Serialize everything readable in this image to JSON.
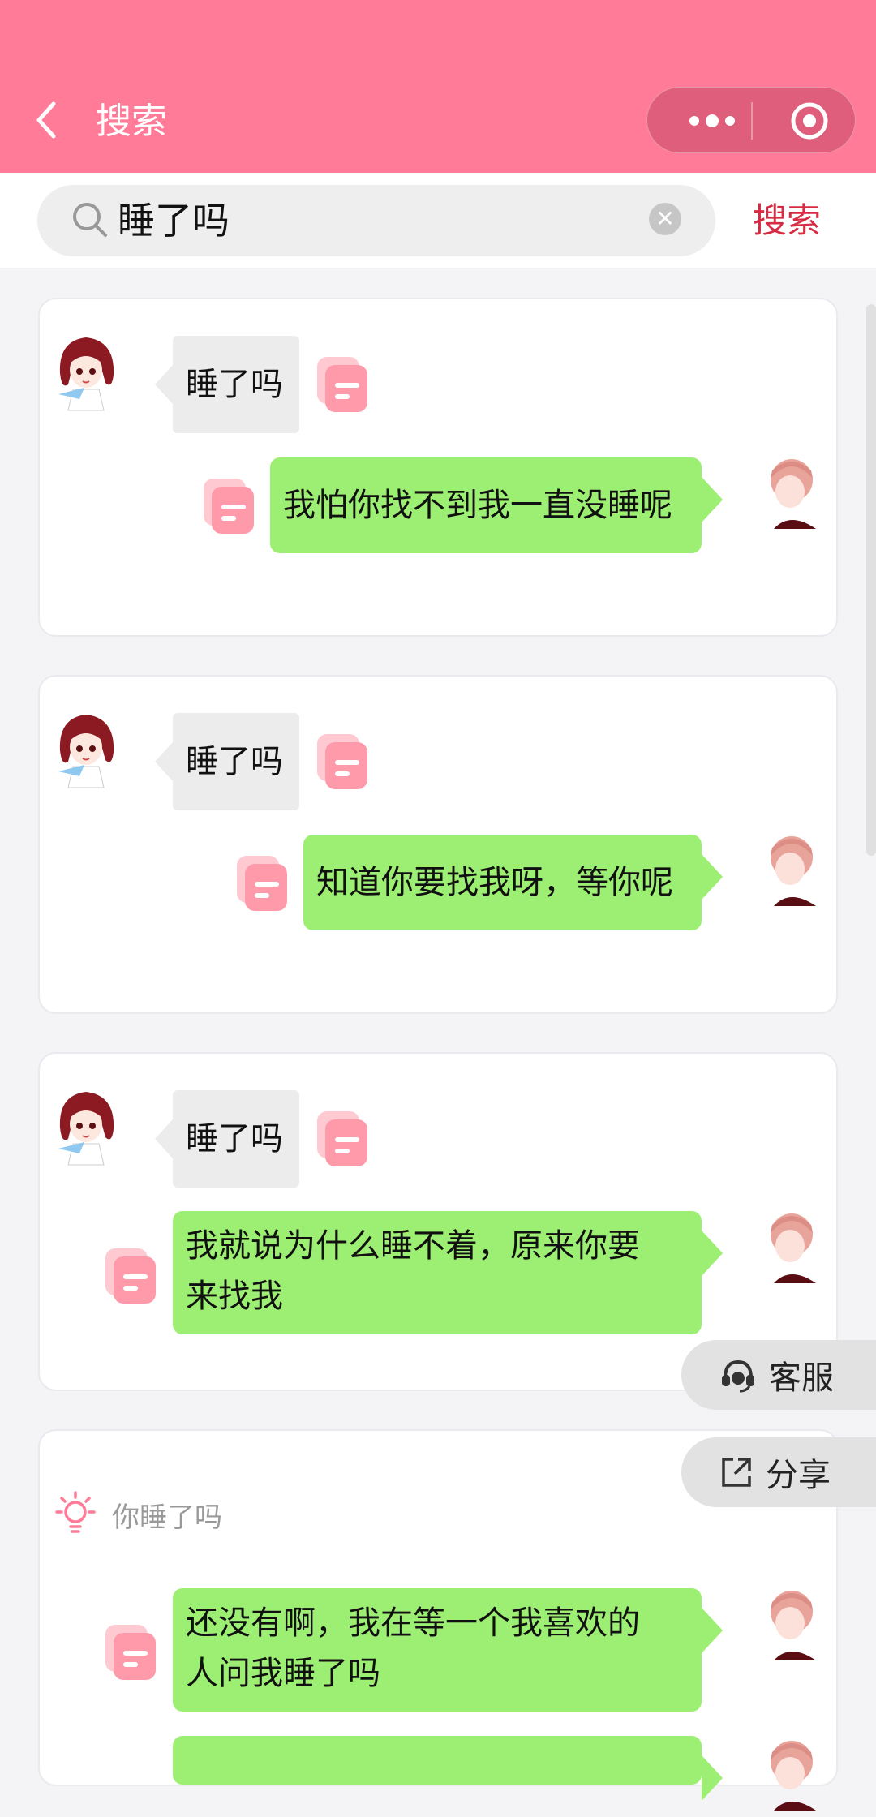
{
  "header": {
    "title": "搜索",
    "colors": {
      "bar": "#ff7b98",
      "accent": "#d52c44",
      "green_bubble": "#9def74"
    }
  },
  "search": {
    "value": "睡了吗",
    "button_label": "搜索"
  },
  "results": [
    {
      "question": "睡了吗",
      "answer": "我怕你找不到我一直没睡呢"
    },
    {
      "question": "睡了吗",
      "answer": "知道你要找我呀，等你呢"
    },
    {
      "question": "睡了吗",
      "answer_line1": "我就说为什么睡不着，原来你要",
      "answer_line2": "来找我"
    },
    {
      "tip": "你睡了吗",
      "answer_line1": "还没有啊，我在等一个我喜欢的",
      "answer_line2": "人问我睡了吗"
    }
  ],
  "floating": {
    "service_label": "客服",
    "share_label": "分享"
  },
  "icons": {
    "back": "chevron-left-icon",
    "more": "more-dots-icon",
    "close": "target-circle-icon",
    "search": "search-icon",
    "clear": "clear-icon",
    "copy": "copy-icon",
    "service": "headset-icon",
    "share": "share-icon",
    "tip": "lightbulb-icon"
  }
}
